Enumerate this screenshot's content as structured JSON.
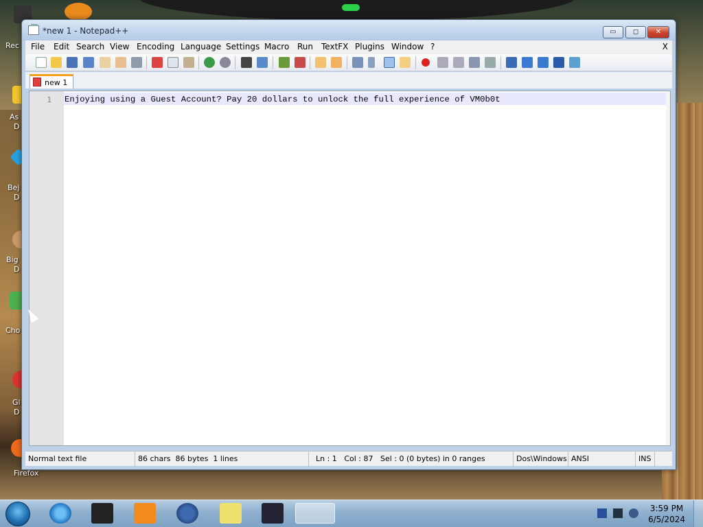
{
  "desktop": {
    "icon_labels": [
      "Rec",
      "As",
      "D",
      "Bej",
      "D",
      "Big",
      "D",
      "Cho",
      "Gl",
      "D",
      "Firefox"
    ]
  },
  "window": {
    "title": "*new 1 - Notepad++",
    "minimize_label": "▭",
    "maximize_label": "◻",
    "close_label": "✕"
  },
  "menu": {
    "items": [
      "File",
      "Edit",
      "Search",
      "View",
      "Encoding",
      "Language",
      "Settings",
      "Macro",
      "Run",
      "TextFX",
      "Plugins",
      "Window",
      "?"
    ],
    "close_label": "X"
  },
  "toolbar": {
    "icons": [
      "new-file-icon",
      "open-file-icon",
      "save-icon",
      "save-all-icon",
      "close-icon",
      "close-all-icon",
      "print-icon",
      "cut-icon",
      "copy-icon",
      "paste-icon",
      "undo-icon",
      "redo-icon",
      "find-icon",
      "replace-icon",
      "zoom-in-icon",
      "zoom-out-icon",
      "sync-v-icon",
      "sync-h-icon",
      "word-wrap-icon",
      "show-all-chars-icon",
      "indent-guide-icon",
      "doc-map-icon",
      "record-macro-icon",
      "stop-macro-icon",
      "play-macro-icon",
      "run-macro-multiple-icon",
      "save-macro-icon",
      "collapse-icon",
      "up-icon",
      "down-icon",
      "sort-icon",
      "spellcheck-icon"
    ]
  },
  "tabs": [
    {
      "label": "new 1"
    }
  ],
  "editor": {
    "line_number": "1",
    "line_text": "Enjoying using a Guest Account? Pay 20 dollars to unlock the full experience of VM0b0t"
  },
  "status": {
    "file_type": "Normal text file",
    "chars": "86 chars",
    "bytes": "86 bytes",
    "lines": "1 lines",
    "ln": "Ln : 1",
    "col": "Col : 87",
    "sel": "Sel : 0 (0 bytes) in 0 ranges",
    "eol": "Dos\\Windows",
    "encoding": "ANSI",
    "mode": "INS"
  },
  "taskbar": {
    "time": "3:59 PM",
    "date": "6/5/2024"
  },
  "colors": {
    "accent_tab": "#f2a020",
    "current_line": "#e8e8ff"
  }
}
